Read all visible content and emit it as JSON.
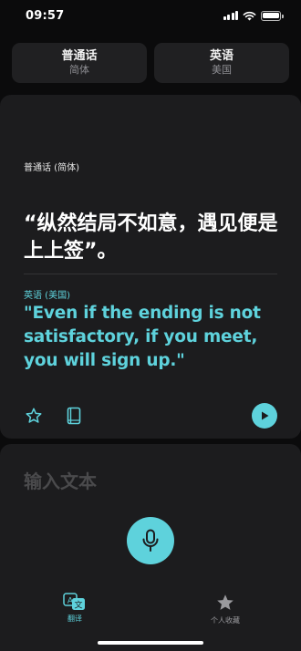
{
  "status_bar": {
    "time": "09:57"
  },
  "language_selector": {
    "source": {
      "name": "普通话",
      "variant": "简体"
    },
    "target": {
      "name": "英语",
      "variant": "美国"
    }
  },
  "translation": {
    "source_label": "普通话 (简体)",
    "source_text": "“纵然结局不如意，遇见便是上上签”。",
    "target_label": "英语 (美国)",
    "target_text": "\"Even if the ending is not satisfactory, if you meet, you will sign up.\""
  },
  "input": {
    "placeholder": "输入文本"
  },
  "tabbar": {
    "translate_label": "翻译",
    "favorites_label": "个人收藏"
  },
  "colors": {
    "accent": "#5ed2dc",
    "background": "#0b0b0c",
    "card": "#1c1c1e"
  },
  "icons": [
    "star-icon",
    "dictionary-book-icon",
    "play-icon",
    "microphone-icon",
    "translate-icon",
    "favorites-star-icon"
  ]
}
